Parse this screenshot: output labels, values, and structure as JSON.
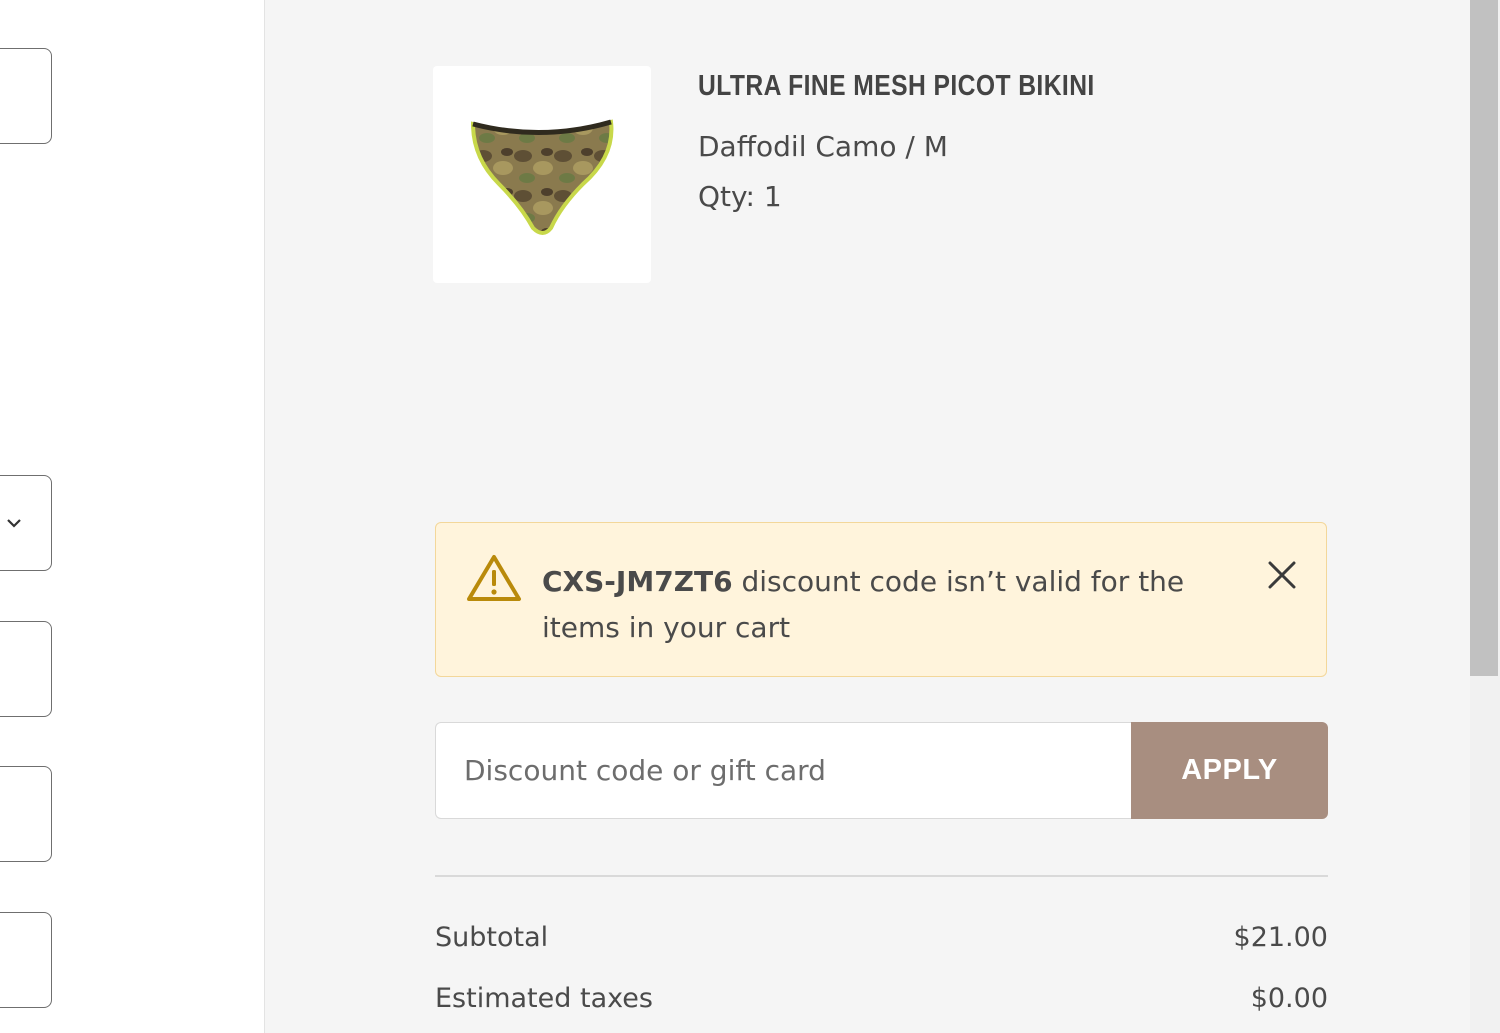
{
  "product": {
    "name": "ULTRA FINE MESH PICOT BIKINI",
    "variant": "Daffodil Camo / M",
    "qty_label": "Qty:",
    "qty_value": "1"
  },
  "notice": {
    "code": "CXS-JM7ZT6",
    "message": " discount code isn’t valid for the items in your cart",
    "icon": "warning-icon",
    "bg_color": "#fff4dc",
    "border_color": "#f3d79a"
  },
  "discount": {
    "placeholder": "Discount code or gift card",
    "value": "",
    "apply_label": "APPLY",
    "apply_color": "#a88e80"
  },
  "totals": {
    "subtotal_label": "Subtotal",
    "subtotal_value": "$21.00",
    "taxes_label": "Estimated taxes",
    "taxes_value": "$0.00"
  }
}
